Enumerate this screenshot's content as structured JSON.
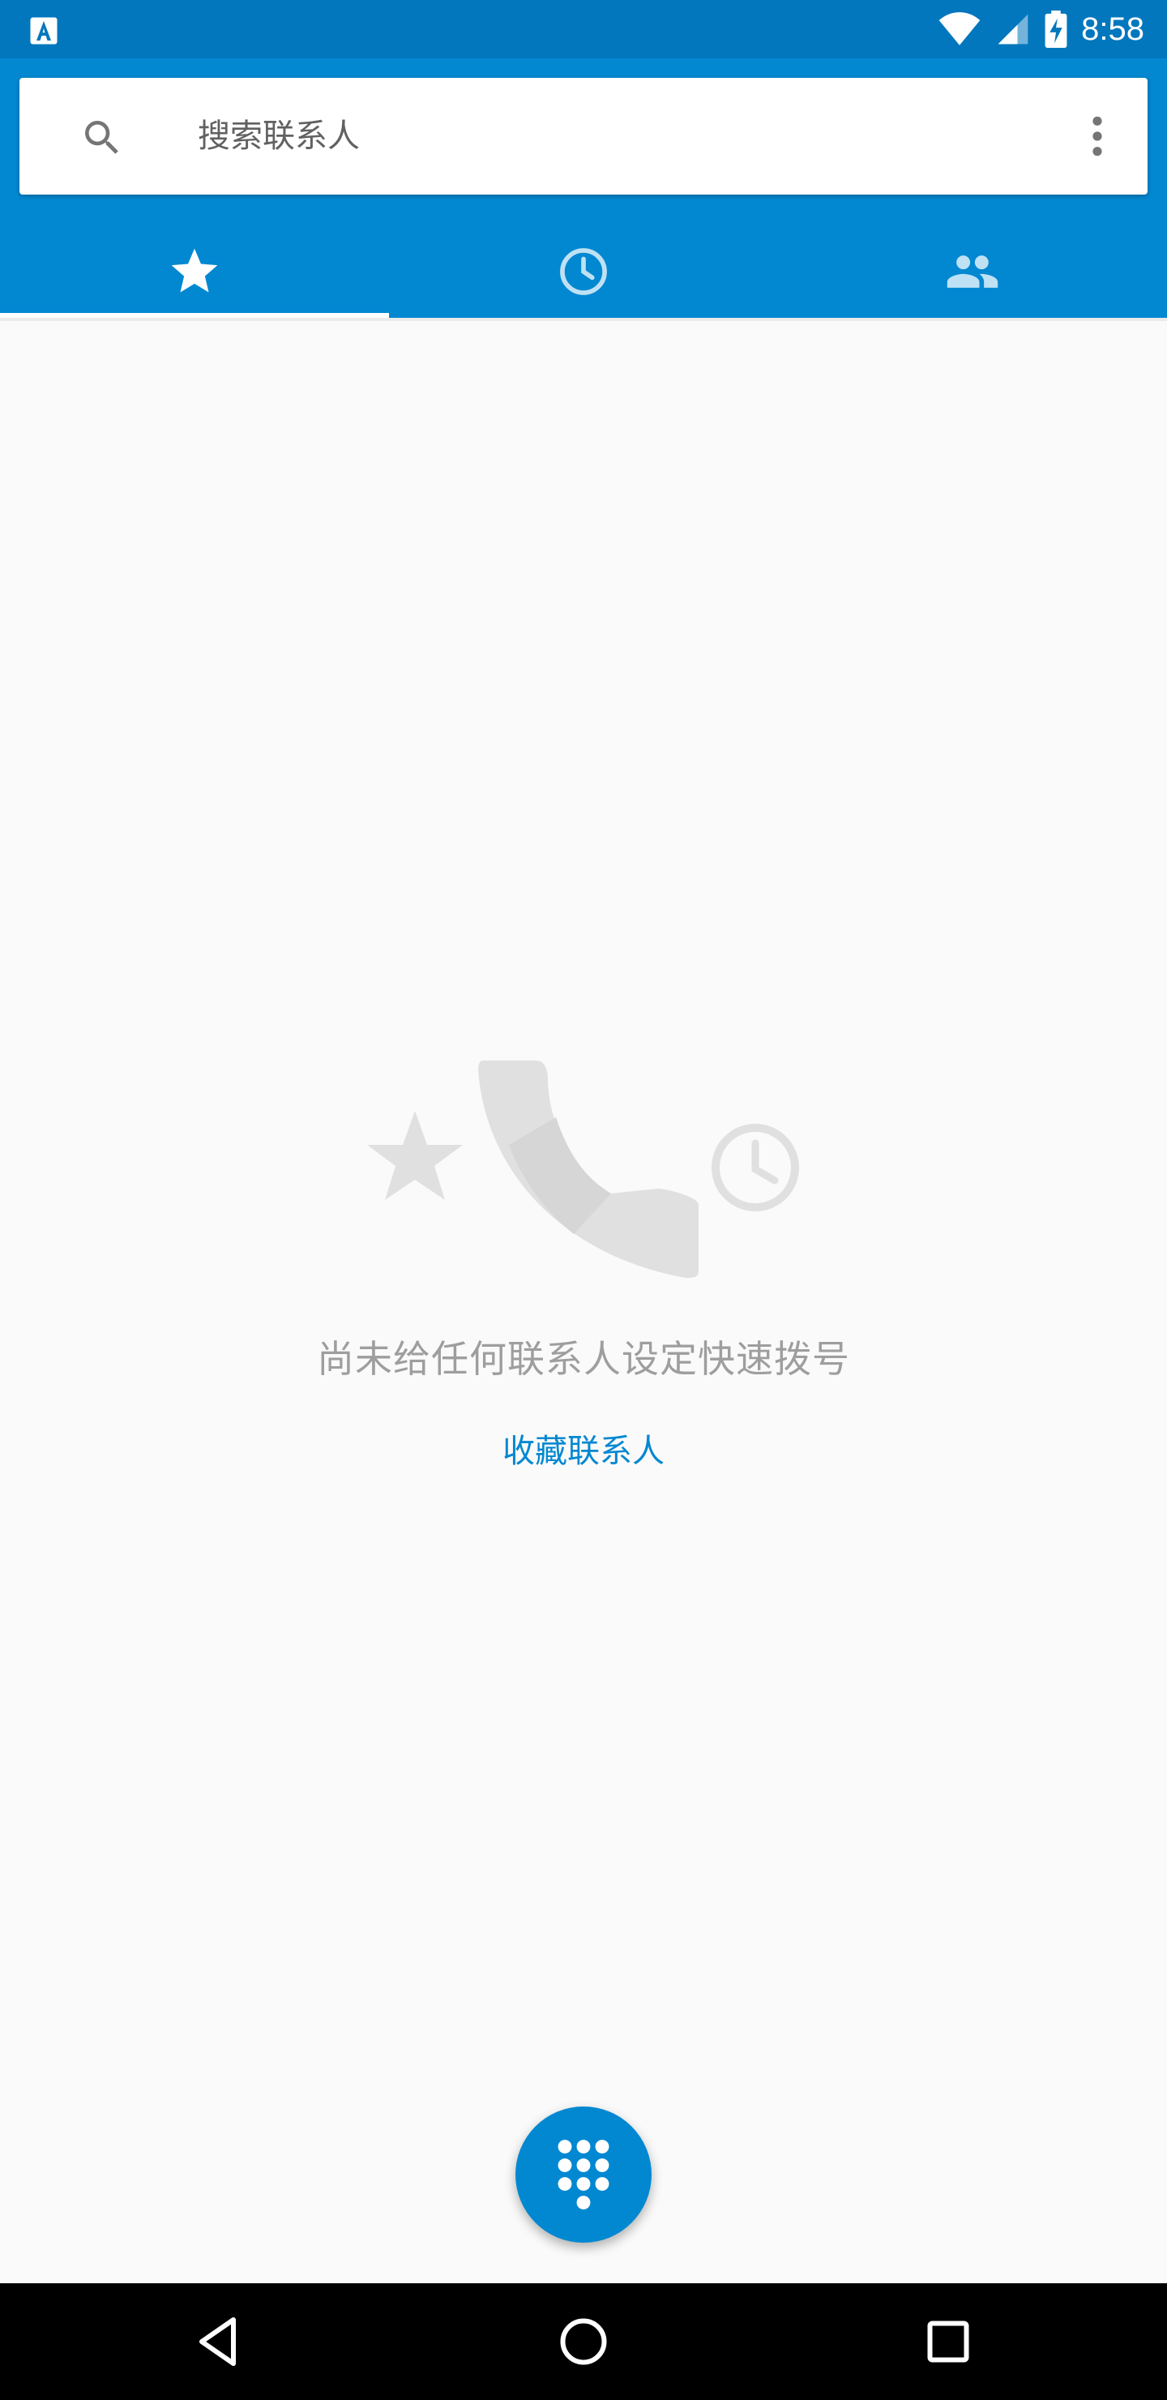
{
  "status_bar": {
    "time": "8:58",
    "icons": [
      "app-notification-icon",
      "wifi-icon",
      "cell-signal-icon",
      "battery-charging-icon"
    ]
  },
  "search": {
    "placeholder": "搜索联系人"
  },
  "tabs": [
    {
      "name": "favorites",
      "icon": "star-icon",
      "selected": true
    },
    {
      "name": "recents",
      "icon": "clock-icon",
      "selected": false
    },
    {
      "name": "contacts",
      "icon": "people-icon",
      "selected": false
    }
  ],
  "empty_state": {
    "message": "尚未给任何联系人设定快速拨号",
    "action_label": "收藏联系人"
  },
  "fab": {
    "icon": "dialpad-icon"
  },
  "nav_bar": {
    "icons": [
      "back-icon",
      "home-icon",
      "recents-icon"
    ]
  },
  "colors": {
    "status_bar": "#0277bd",
    "header": "#0288d1",
    "accent": "#0288d1",
    "background": "#fafafa",
    "illustration": "#e0e0e0"
  }
}
